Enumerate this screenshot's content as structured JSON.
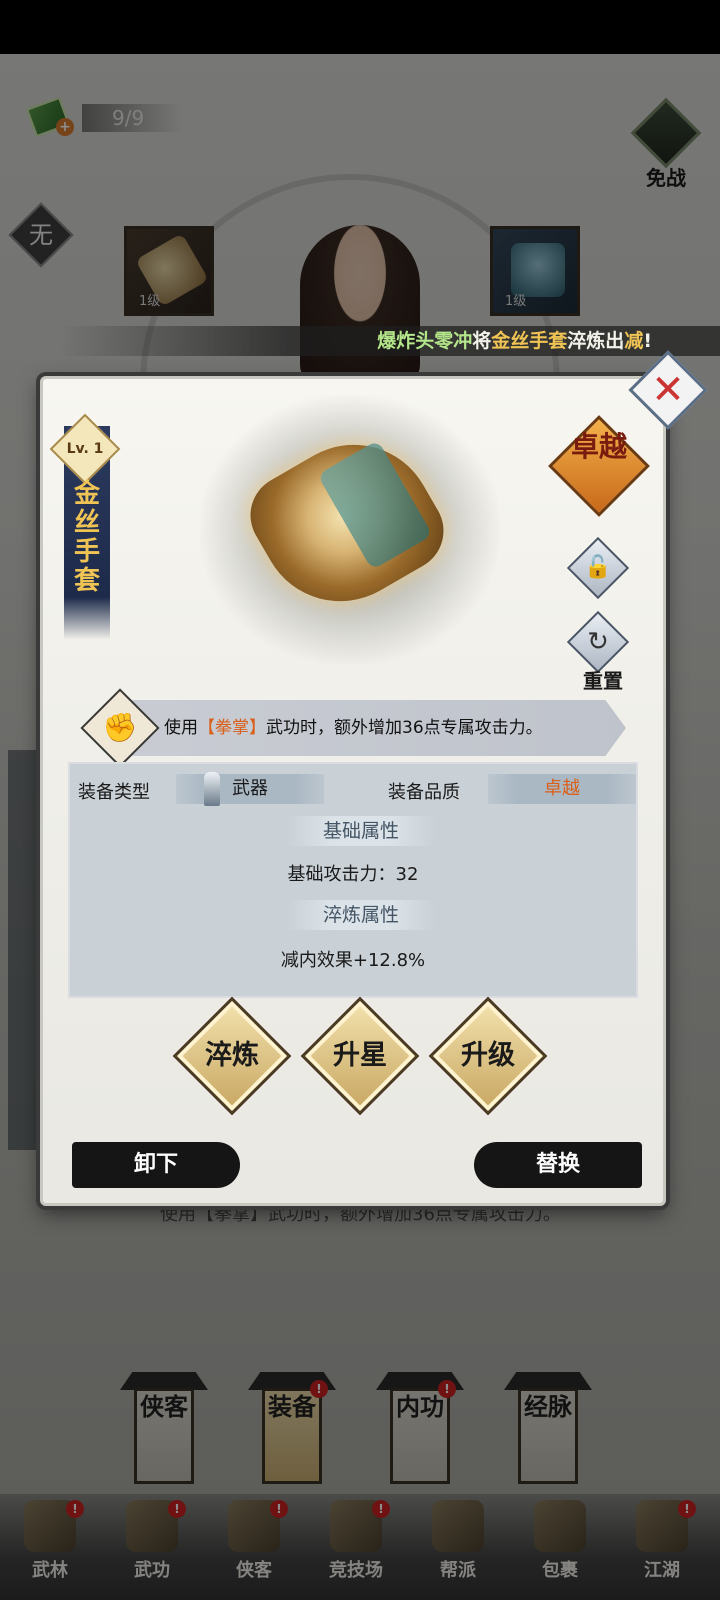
{
  "top": {
    "ticket_count": "9/9",
    "avoid_battle_label": "免战",
    "none_label": "无"
  },
  "slots": {
    "left_level": "1级",
    "right_level": "1级"
  },
  "broadcast": {
    "player": "爆炸头零冲",
    "verb": "将",
    "item": "金丝手套",
    "middle": "淬炼出",
    "attr": "减",
    "end": "!"
  },
  "item": {
    "level": "Lv. 1",
    "name": "金丝手套",
    "quality_badge": "卓越",
    "reset_label": "重置",
    "skill_prefix": "使用",
    "skill_name": "【拳掌】",
    "skill_suffix": "武功时，额外增加36点专属攻击力。",
    "type_label": "装备类型",
    "type_value": "武器",
    "quality_label": "装备品质",
    "quality_value": "卓越",
    "base_section": "基础属性",
    "base_stat": "基础攻击力：32",
    "refine_section": "淬炼属性",
    "refine_stat": "减内效果+12.8%"
  },
  "actions": {
    "refine": "淬炼",
    "star": "升星",
    "upgrade": "升级",
    "unequip": "卸下",
    "replace": "替换"
  },
  "tabs": [
    {
      "label": "侠客",
      "alert": false
    },
    {
      "label": "装备",
      "alert": true
    },
    {
      "label": "内功",
      "alert": true
    },
    {
      "label": "经脉",
      "alert": false
    }
  ],
  "nav": [
    {
      "label": "武林",
      "alert": true
    },
    {
      "label": "武功",
      "alert": true
    },
    {
      "label": "侠客",
      "alert": true
    },
    {
      "label": "竞技场",
      "alert": true
    },
    {
      "label": "帮派",
      "alert": false
    },
    {
      "label": "包裹",
      "alert": false
    },
    {
      "label": "江湖",
      "alert": true
    }
  ],
  "background_ghost_text": "使用【拳掌】武功时，额外增加36点专属攻击力。",
  "colors": {
    "quality_orange": "#d9601a",
    "broadcast_name": "#b4e68a",
    "broadcast_item": "#f0c454",
    "alert_red": "#cc2222"
  }
}
